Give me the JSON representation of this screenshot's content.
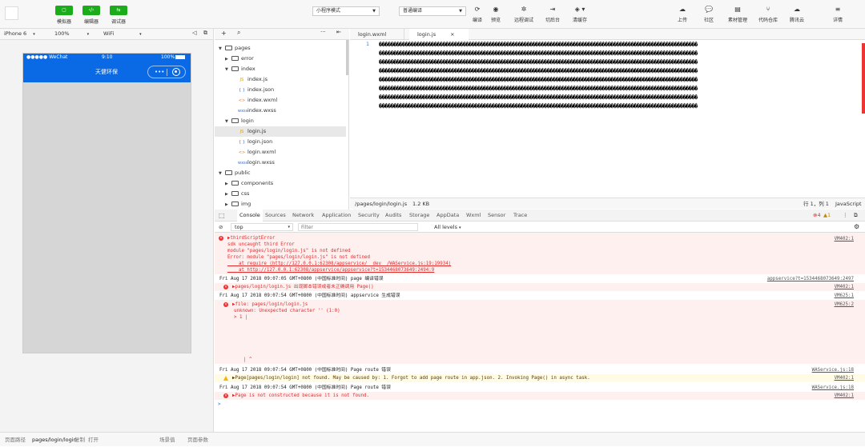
{
  "toolbar": {
    "buttons": [
      {
        "label": "模拟器",
        "icon": "phone-icon"
      },
      {
        "label": "编辑器",
        "icon": "code-icon"
      },
      {
        "label": "调试器",
        "icon": "debug-icon"
      }
    ],
    "mode_select": "小程序模式",
    "compile_select": "普通编译",
    "center_tools": [
      {
        "label": "编译",
        "icon": "refresh-icon"
      },
      {
        "label": "预览",
        "icon": "eye-icon"
      },
      {
        "label": "远程调试",
        "icon": "bug-icon"
      },
      {
        "label": "切后台",
        "icon": "switch-icon"
      },
      {
        "label": "清缓存",
        "icon": "clear-icon"
      }
    ],
    "right_tools": [
      {
        "label": "上传",
        "icon": "cloud-upload-icon"
      },
      {
        "label": "社区",
        "icon": "chat-icon"
      },
      {
        "label": "素材管理",
        "icon": "doc-icon"
      },
      {
        "label": "代码仓库",
        "icon": "branch-icon"
      },
      {
        "label": "腾讯云",
        "icon": "cloud-icon"
      },
      {
        "label": "详情",
        "icon": "menu-icon"
      }
    ]
  },
  "simulator": {
    "device": "iPhone 6",
    "zoom": "100%",
    "network": "WiFi",
    "status": {
      "carrier": "●●●●● WeChat",
      "time": "9:10",
      "battery": "100%"
    },
    "nav_title": "天健环保",
    "capsule_dots": "•••"
  },
  "tree": {
    "items": [
      {
        "label": "pages",
        "kind": "folder",
        "open": true,
        "depth": 0
      },
      {
        "label": "error",
        "kind": "folder",
        "open": false,
        "depth": 1
      },
      {
        "label": "index",
        "kind": "folder",
        "open": true,
        "depth": 1
      },
      {
        "label": "index.js",
        "kind": "js",
        "depth": 2
      },
      {
        "label": "index.json",
        "kind": "json",
        "depth": 2
      },
      {
        "label": "index.wxml",
        "kind": "wxml",
        "depth": 2
      },
      {
        "label": "index.wxss",
        "kind": "wxss",
        "depth": 2
      },
      {
        "label": "login",
        "kind": "folder",
        "open": true,
        "depth": 1
      },
      {
        "label": "login.js",
        "kind": "js",
        "depth": 2,
        "selected": true
      },
      {
        "label": "login.json",
        "kind": "json",
        "depth": 2
      },
      {
        "label": "login.wxml",
        "kind": "wxml",
        "depth": 2
      },
      {
        "label": "login.wxss",
        "kind": "wxss",
        "depth": 2
      },
      {
        "label": "public",
        "kind": "folder",
        "open": true,
        "depth": 0
      },
      {
        "label": "components",
        "kind": "folder",
        "open": false,
        "depth": 1
      },
      {
        "label": "css",
        "kind": "folder",
        "open": false,
        "depth": 1
      },
      {
        "label": "img",
        "kind": "folder",
        "open": false,
        "depth": 1
      }
    ],
    "file_icons": {
      "js": "JS",
      "json": "{ }",
      "wxml": "<>",
      "wxss": "wxss"
    }
  },
  "editor": {
    "tabs": [
      {
        "label": "login.wxml",
        "active": false
      },
      {
        "label": "login.js",
        "active": true
      }
    ],
    "line_number": "1",
    "garbled_char": "�",
    "garbled_lines": 8,
    "path": "/pages/login/login.js",
    "size": "1.2 KB",
    "cursor": "行 1，列 1",
    "language": "JavaScript"
  },
  "devtools": {
    "tabs": [
      "Console",
      "Sources",
      "Network",
      "Application",
      "Security",
      "Audits",
      "Storage",
      "AppData",
      "Wxml",
      "Sensor",
      "Trace"
    ],
    "error_count": "4",
    "warning_count": "1",
    "context": "top",
    "filter_placeholder": "Filter",
    "levels": "All levels"
  },
  "console": {
    "block1": {
      "lines": [
        "▶thirdScriptError",
        "sdk uncaught third Error",
        "module \"pages/login/login.js\" is not defined",
        "Error: module \"pages/login/login.js\" is not defined",
        "    at require (http://127.0.0.1:62308/appservice/__dev__/WAService.js:19:19934)",
        "    at http://127.0.0.1:62308/appservice/appservice?t=1534468073649:2494:9"
      ],
      "source": "VM402:1"
    },
    "group1": {
      "text": "Fri Aug 17 2018 09:07:05 GMT+0800 (中国标准时间) page 编译错误",
      "source": "appservice?t=1534468073649:2497"
    },
    "err1": {
      "text": "▶pages/login/login.js 出现脚本错误或者未正确调用 Page()",
      "source": "VM402:1"
    },
    "group2": {
      "text": "Fri Aug 17 2018 09:07:54 GMT+0800 (中国标准时间) appservice 生成错误",
      "source": "VM625:1"
    },
    "err2": {
      "lines": [
        "▶file: pages/login/login.js",
        "unknown: Unexpected character '' (1:0)",
        "> 1 |"
      ],
      "caret": "| ^",
      "source": "VM625:2"
    },
    "group3": {
      "text": "Fri Aug 17 2018 09:07:54 GMT+0800 (中国标准时间) Page route 错误",
      "source": "WAService.js:18"
    },
    "warn1": {
      "text": "▶Page[pages/login/login] not found. May be caused by: 1. Forgot to add page route in app.json. 2. Invoking Page() in async task.",
      "source": "VM402:1"
    },
    "group4": {
      "text": "Fri Aug 17 2018 09:07:54 GMT+0800 (中国标准时间) Page route 错误",
      "source": "WAService.js:18"
    },
    "err3": {
      "text": "▶Page is not constructed because it is not found.",
      "source": "VM402:1"
    },
    "prompt": ">"
  },
  "bottom": {
    "path_label": "页面路径",
    "path": "pages/login/login",
    "copy": "复制",
    "open": "打开",
    "scene": "场景值",
    "params": "页面参数"
  },
  "colors": {
    "green": "#1aad19",
    "nav_blue": "#0a6ae6",
    "error_red": "#e02a2a",
    "error_bg": "#fff0f0",
    "warn_bg": "#fffbe5"
  }
}
